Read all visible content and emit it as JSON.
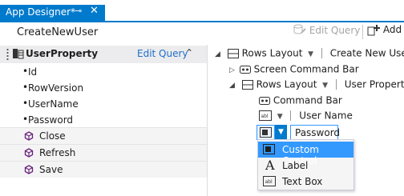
{
  "tab": {
    "title": "App Designer*",
    "pin_glyph": "⊸",
    "close_glyph": "✕"
  },
  "header": {
    "screen_name": "CreateNewUser",
    "edit_query_label": "Edit Query",
    "add_label": "Add"
  },
  "left_panel": {
    "title": "UserProperty",
    "edit_query_link": "Edit Query",
    "collapse_glyph": "⌃",
    "properties": [
      "Id",
      "RowVersion",
      "UserName",
      "Password"
    ],
    "methods": [
      "Close",
      "Refresh",
      "Save"
    ]
  },
  "tree": {
    "root_layout": "Rows Layout",
    "root_label": "Create New User",
    "screen_command_bar": "Screen Command Bar",
    "child_layout": "Rows Layout",
    "child_label": "User Property",
    "command_bar": "Command Bar",
    "user_name_label": "User Name",
    "password_label": "Password"
  },
  "menu": {
    "items": [
      {
        "label": "Custom Control",
        "icon": "custom-control-icon",
        "selected": true
      },
      {
        "label": "Label",
        "icon": "label-icon",
        "selected": false
      },
      {
        "label": "Text Box",
        "icon": "textbox-icon",
        "selected": false
      }
    ]
  },
  "colors": {
    "accent": "#007acc",
    "selection": "#3399ff",
    "link": "#1e6fc8",
    "method_icon": "#68217a"
  }
}
